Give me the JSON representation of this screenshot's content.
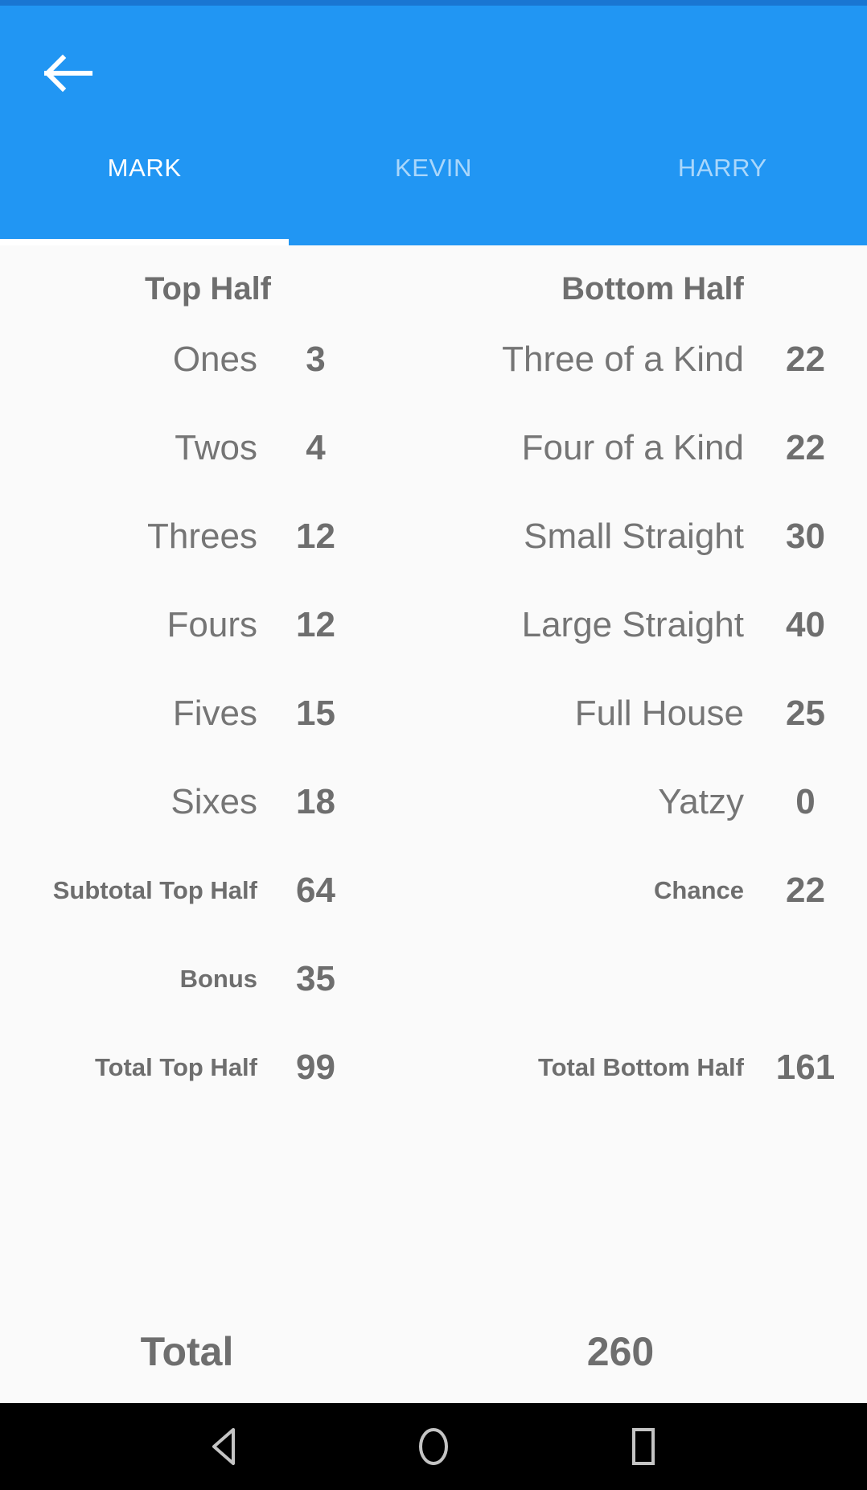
{
  "theme": {
    "primary": "#2196F3",
    "primary_dark": "#1976D2",
    "content_bg": "#FAFAFA",
    "text_muted": "#757575",
    "text_value": "#6E6E6E",
    "navbar_bg": "#000000"
  },
  "appbar": {
    "back_icon": "arrow-left-icon",
    "tabs": [
      {
        "label": "MARK",
        "active": true
      },
      {
        "label": "KEVIN",
        "active": false
      },
      {
        "label": "HARRY",
        "active": false
      }
    ],
    "active_tab_index": 0
  },
  "scorecard": {
    "headers": {
      "top_half": "Top Half",
      "bottom_half": "Bottom Half"
    },
    "rows": [
      {
        "left_label": "Ones",
        "left_value": "3",
        "right_label": "Three of a Kind",
        "right_value": "22",
        "summary": false
      },
      {
        "left_label": "Twos",
        "left_value": "4",
        "right_label": "Four of a Kind",
        "right_value": "22",
        "summary": false
      },
      {
        "left_label": "Threes",
        "left_value": "12",
        "right_label": "Small Straight",
        "right_value": "30",
        "summary": false
      },
      {
        "left_label": "Fours",
        "left_value": "12",
        "right_label": "Large Straight",
        "right_value": "40",
        "summary": false
      },
      {
        "left_label": "Fives",
        "left_value": "15",
        "right_label": "Full House",
        "right_value": "25",
        "summary": false
      },
      {
        "left_label": "Sixes",
        "left_value": "18",
        "right_label": "Yatzy",
        "right_value": "0",
        "summary": false
      },
      {
        "left_label": "Subtotal Top Half",
        "left_value": "64",
        "right_label": "Chance",
        "right_value": "22",
        "summary": "left"
      },
      {
        "left_label": "Bonus",
        "left_value": "35",
        "right_label": "",
        "right_value": "",
        "summary": "left"
      },
      {
        "left_label": "Total Top Half",
        "left_value": "99",
        "right_label": "Total Bottom Half",
        "right_value": "161",
        "summary": "both"
      }
    ],
    "total": {
      "label": "Total",
      "value": "260"
    }
  },
  "navbar": {
    "back": "nav-back-icon",
    "home": "nav-home-icon",
    "recents": "nav-recents-icon"
  }
}
